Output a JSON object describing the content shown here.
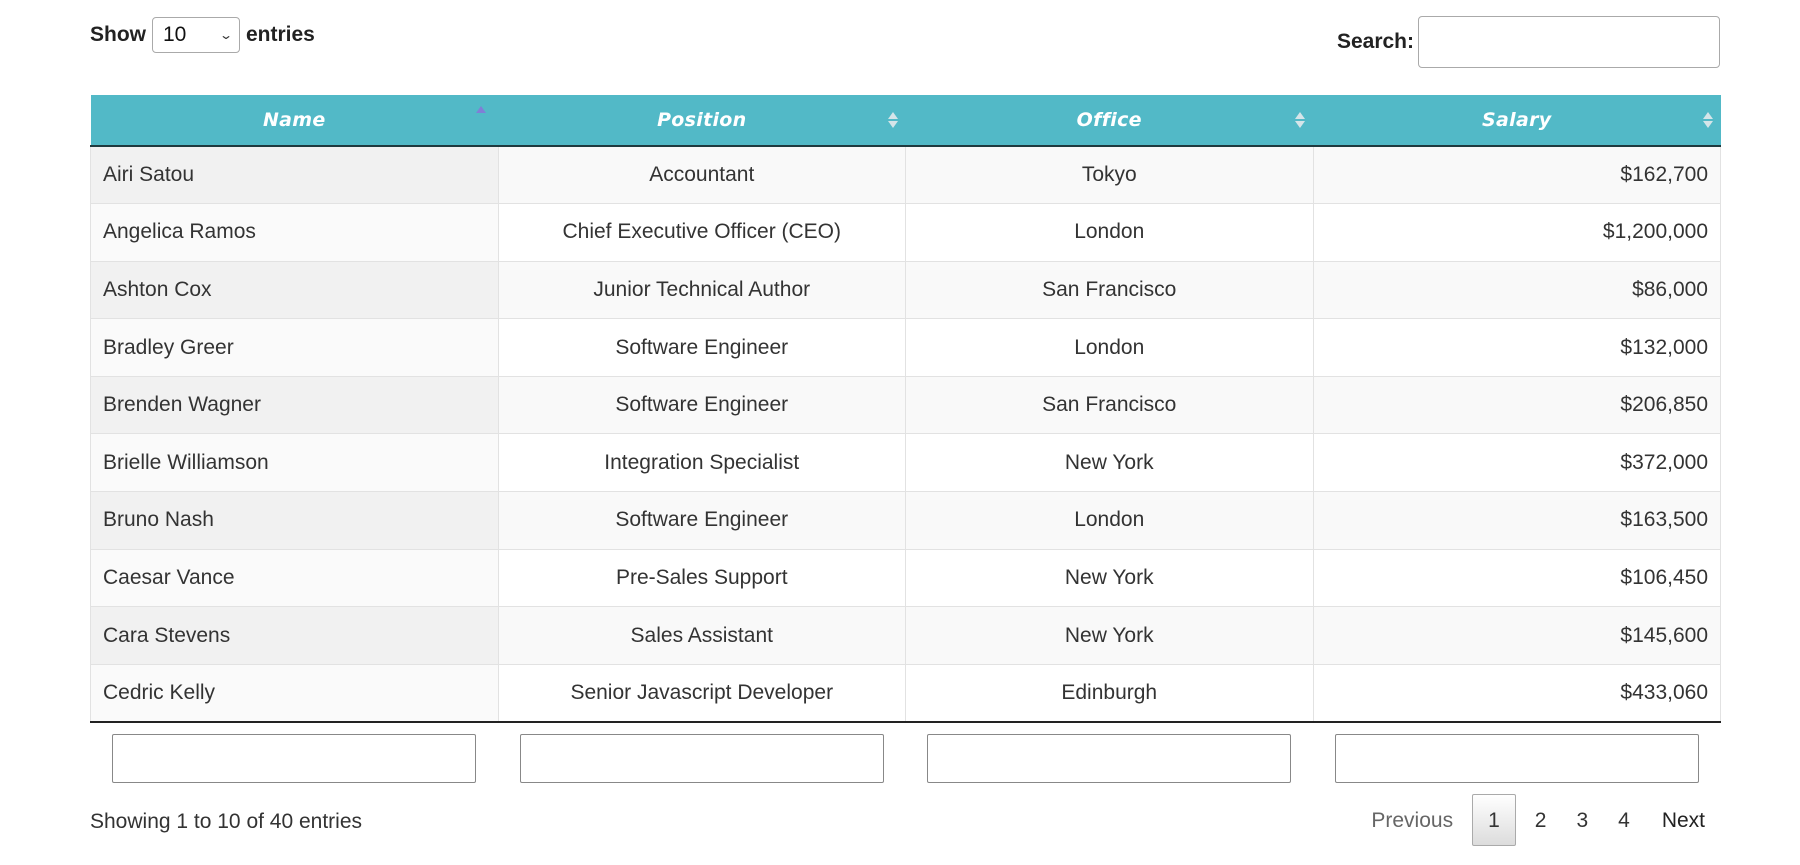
{
  "controls": {
    "length_label_before": "Show",
    "length_value": "10",
    "length_label_after": "entries",
    "search_label": "Search:",
    "search_value": "",
    "search_placeholder": ""
  },
  "table": {
    "columns": [
      {
        "label": "Name",
        "sort": "ascending"
      },
      {
        "label": "Position",
        "sort": "none"
      },
      {
        "label": "Office",
        "sort": "none"
      },
      {
        "label": "Salary",
        "sort": "none"
      }
    ],
    "rows": [
      {
        "name": "Airi Satou",
        "position": "Accountant",
        "office": "Tokyo",
        "salary": "$162,700"
      },
      {
        "name": "Angelica Ramos",
        "position": "Chief Executive Officer (CEO)",
        "office": "London",
        "salary": "$1,200,000"
      },
      {
        "name": "Ashton Cox",
        "position": "Junior Technical Author",
        "office": "San Francisco",
        "salary": "$86,000"
      },
      {
        "name": "Bradley Greer",
        "position": "Software Engineer",
        "office": "London",
        "salary": "$132,000"
      },
      {
        "name": "Brenden Wagner",
        "position": "Software Engineer",
        "office": "San Francisco",
        "salary": "$206,850"
      },
      {
        "name": "Brielle Williamson",
        "position": "Integration Specialist",
        "office": "New York",
        "salary": "$372,000"
      },
      {
        "name": "Bruno Nash",
        "position": "Software Engineer",
        "office": "London",
        "salary": "$163,500"
      },
      {
        "name": "Caesar Vance",
        "position": "Pre-Sales Support",
        "office": "New York",
        "salary": "$106,450"
      },
      {
        "name": "Cara Stevens",
        "position": "Sales Assistant",
        "office": "New York",
        "salary": "$145,600"
      },
      {
        "name": "Cedric Kelly",
        "position": "Senior Javascript Developer",
        "office": "Edinburgh",
        "salary": "$433,060"
      }
    ],
    "footer_filters": [
      {
        "value": ""
      },
      {
        "value": ""
      },
      {
        "value": ""
      },
      {
        "value": ""
      }
    ]
  },
  "info": "Showing 1 to 10 of 40 entries",
  "pagination": {
    "previous": "Previous",
    "pages": [
      "1",
      "2",
      "3",
      "4"
    ],
    "current_page": "1",
    "next": "Next"
  },
  "colors": {
    "header_bg": "#52b9c7",
    "header_text": "#ffffff",
    "sort_active": "#7f7fd6"
  }
}
